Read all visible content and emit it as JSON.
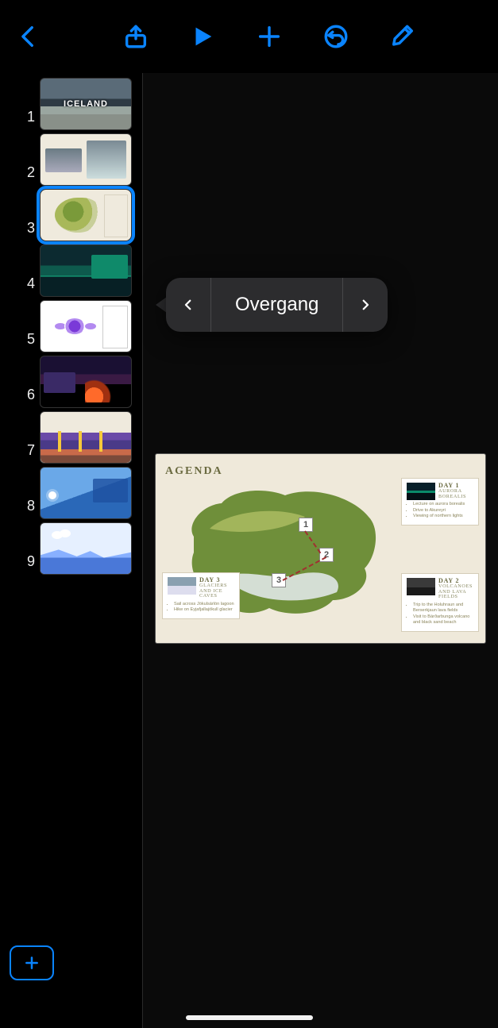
{
  "popover": {
    "label": "Overgang"
  },
  "slides": [
    {
      "n": "1",
      "title": "ICELAND"
    },
    {
      "n": "2",
      "title": ""
    },
    {
      "n": "3",
      "title": ""
    },
    {
      "n": "4",
      "title": ""
    },
    {
      "n": "5",
      "title": ""
    },
    {
      "n": "6",
      "title": ""
    },
    {
      "n": "7",
      "title": ""
    },
    {
      "n": "8",
      "title": ""
    },
    {
      "n": "9",
      "title": ""
    }
  ],
  "selected_slide_index": 2,
  "preview": {
    "title": "AGENDA",
    "pins": [
      "1",
      "2",
      "3"
    ],
    "day1": {
      "head": "DAY 1",
      "sub": "AURORA BOREALIS",
      "i1": "Lecture on aurora borealis",
      "i2": "Drive to Akureyri",
      "i3": "Viewing of northern lights"
    },
    "day2": {
      "head": "DAY 2",
      "sub": "VOLCANOES AND LAVA FIELDS",
      "i1": "Trip to the Holuhraun and Berserkjaun lava fields",
      "i2": "Visit to Bárðarbunga volcano and black sand beach"
    },
    "day3": {
      "head": "DAY 3",
      "sub": "GLACIERS AND ICE CAVES",
      "i1": "Sail across Jökulsárlón lagoon",
      "i2": "Hike on Eyjafjallajökull glacier"
    }
  }
}
